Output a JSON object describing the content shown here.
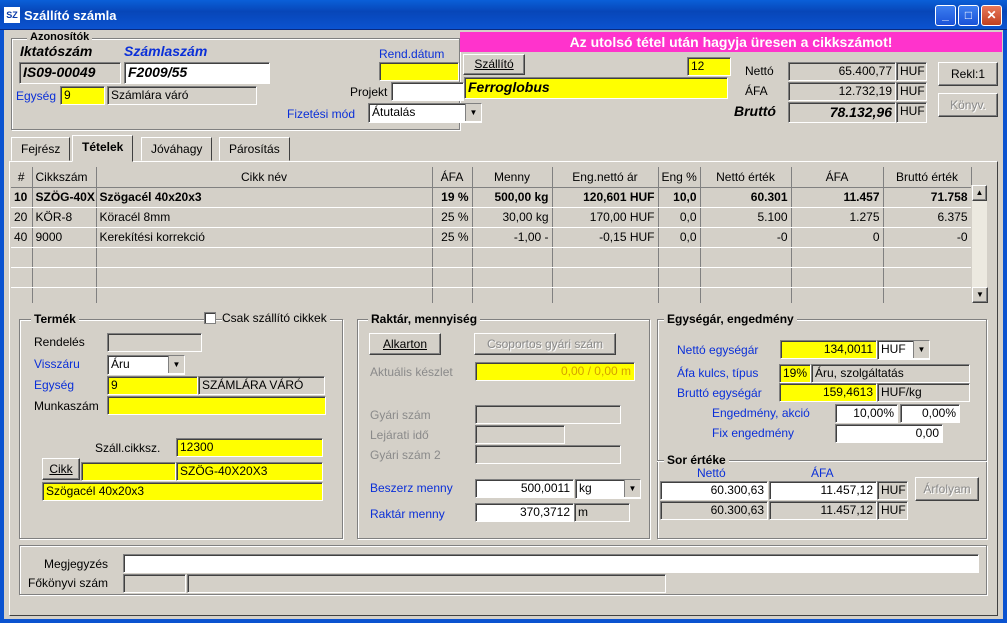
{
  "window": {
    "title": "Szállító számla",
    "icon": "app-icon"
  },
  "header": {
    "azonositok": "Azonosítók",
    "iktato_label": "Iktatószám",
    "iktato_value": "IS09-00049",
    "szamlaszam_label": "Számlaszám",
    "szamlaszam_value": "F2009/55",
    "egyseg_label": "Egység",
    "egyseg_value": "9",
    "egyseg_text": "Számlára váró",
    "rend_datum_label": "Rend.dátum",
    "rend_datum_value": "",
    "banner": "Az utolsó tétel után hagyja üresen a cikkszámot!",
    "szallito_button": "Szállító",
    "szallito_code": "12",
    "szallito_name": "Ferroglobus",
    "projekt_label": "Projekt",
    "projekt_value": "",
    "fizetesi_label": "Fizetési mód",
    "fizetesi_value": "Átutalás",
    "netto_label": "Nettó",
    "netto_value": "65.400,77",
    "netto_cur": "HUF",
    "afa_label": "ÁFA",
    "afa_value": "12.732,19",
    "afa_cur": "HUF",
    "brutto_label": "Bruttó",
    "brutto_value": "78.132,96",
    "brutto_cur": "HUF",
    "rekl_button": "Rekl:1",
    "konyv_button": "Könyv."
  },
  "tabs": [
    "Fejrész",
    "Tételek",
    "Jóváhagy",
    "Párosítás"
  ],
  "grid": {
    "columns": [
      "#",
      "Cikkszám",
      "Cikk név",
      "ÁFA",
      "Menny",
      "Eng.nettó ár",
      "Eng %",
      "Nettó érték",
      "ÁFA",
      "Bruttó érték"
    ],
    "rows": [
      [
        "10",
        "SZÖG-40X",
        "Szögacél 40x20x3",
        "19 %",
        "500,00 kg",
        "120,601 HUF",
        "10,0",
        "60.301",
        "11.457",
        "71.758"
      ],
      [
        "20",
        "KÖR-8",
        "Köracél 8mm",
        "25 %",
        "30,00 kg",
        "170,00 HUF",
        "0,0",
        "5.100",
        "1.275",
        "6.375"
      ],
      [
        "40",
        "9000",
        "Kerekítési korrekció",
        "25 %",
        "-1,00 -",
        "-0,15 HUF",
        "0,0",
        "-0",
        "0",
        "-0"
      ]
    ]
  },
  "termek": {
    "title": "Termék",
    "csak_label": "Csak szállító cikkek",
    "rendeles_label": "Rendelés",
    "rendeles_value": "",
    "visszaru_label": "Visszáru",
    "visszaru_value": "Áru",
    "egyseg_label": "Egység",
    "egyseg_value": "9",
    "egyseg_text": "SZÁMLÁRA VÁRÓ",
    "munkaszam_label": "Munkaszám",
    "munkaszam_value": "",
    "szall_label": "Száll.cikksz.",
    "szall_value": "12300",
    "cikk_button": "Cikk",
    "cikk_value": "",
    "cikk_code": "SZÖG-40X20X3",
    "cikk_name": "Szögacél 40x20x3"
  },
  "raktar": {
    "title": "Raktár, mennyiség",
    "alkarton_button": "Alkarton",
    "csoportos_button": "Csoportos gyári szám",
    "aktualis_label": "Aktuális készlet",
    "aktualis_value": "0,00 / 0,00 m",
    "gyari_label": "Gyári szám",
    "lejarat_label": "Lejárati idő",
    "gyari2_label": "Gyári szám 2",
    "beszerz_label": "Beszerz menny",
    "beszerz_value": "500,0011",
    "beszerz_unit": "kg",
    "raktar_label": "Raktár menny",
    "raktar_value": "370,3712",
    "raktar_unit": "m"
  },
  "egysegar": {
    "title": "Egységár, engedmény",
    "netto_label": "Nettó egységár",
    "netto_value": "134,0011",
    "netto_cur": "HUF",
    "afa_label": "Áfa kulcs, típus",
    "afa_rate": "19%",
    "afa_type": "Áru, szolgáltatás",
    "brutto_label": "Bruttó egységár",
    "brutto_value": "159,4613",
    "brutto_unit": "HUF/kg",
    "eng_label": "Engedmény, akció",
    "eng_value": "10,00%",
    "akcio_value": "0,00%",
    "fix_label": "Fix engedmény",
    "fix_value": "0,00"
  },
  "sor": {
    "title": "Sor értéke",
    "netto_label": "Nettó",
    "afa_label": "ÁFA",
    "r1_netto": "60.300,63",
    "r1_afa": "11.457,12",
    "r1_cur": "HUF",
    "r2_netto": "60.300,63",
    "r2_afa": "11.457,12",
    "r2_cur": "HUF",
    "arfolyam_button": "Árfolyam"
  },
  "footer": {
    "megjegyzes_label": "Megjegyzés",
    "megjegyzes_value": "",
    "fokonyv_label": "Főkönyvi szám",
    "fokonyv_value": "",
    "fokonyv_text": ""
  },
  "colors": {
    "banner": "#ff33cc",
    "yellow": "#ffff00",
    "titlebar": "#0b53d0"
  }
}
